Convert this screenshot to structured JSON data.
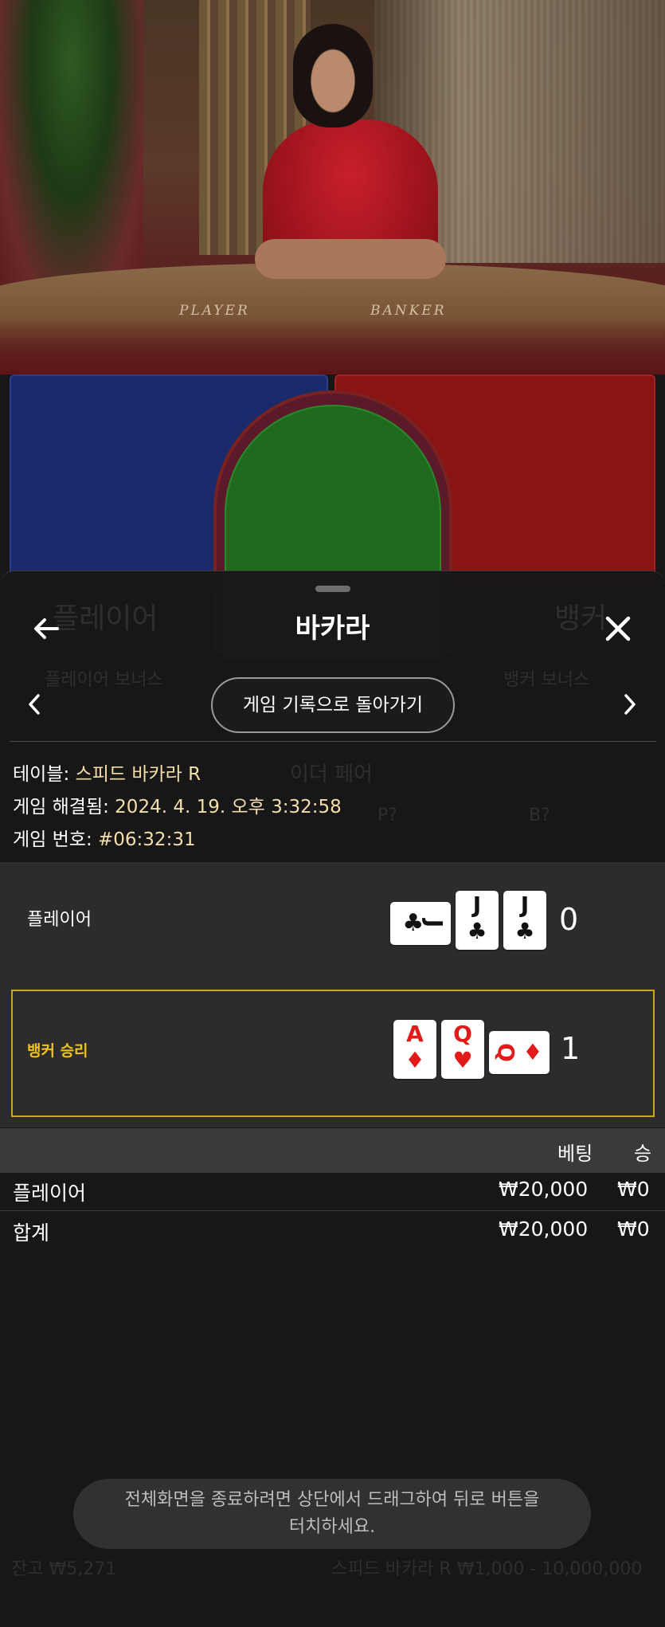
{
  "video": {
    "table_label_player": "PLAYER",
    "table_label_banker": "BANKER"
  },
  "sheet": {
    "title": "바카라",
    "back_icon": "arrow-left-icon",
    "close_icon": "close-icon",
    "history_button": "게임 기록으로 돌아가기",
    "prev_icon": "chevron-left-icon",
    "next_icon": "chevron-right-icon"
  },
  "background_ghost": {
    "player": "플레이어",
    "banker": "뱅커",
    "player_bonus": "플레이어 보너스",
    "banker_bonus": "뱅커 보너스",
    "either_pair": "이더 페어",
    "player_pair_hint": "P?",
    "banker_pair_hint": "B?",
    "balance_ghost": "잔고 ₩5,271",
    "table_limits_ghost": "스피드 바카라 R  ₩1,000 - 10,000,000"
  },
  "game_info": {
    "table_label": "테이블: ",
    "table_value": "스피드 바카라 R",
    "resolved_label": "게임 해결됨: ",
    "resolved_value": "2024. 4. 19. 오후 3:32:58",
    "number_label": "게임 번호: ",
    "number_value": "#06:32:31"
  },
  "results": {
    "player": {
      "label": "플레이어",
      "score": "0",
      "cards": [
        {
          "rank": "J",
          "suit": "♣",
          "color": "black",
          "orientation": "sideways"
        },
        {
          "rank": "J",
          "suit": "♣",
          "color": "black",
          "orientation": "upright"
        },
        {
          "rank": "J",
          "suit": "♣",
          "color": "black",
          "orientation": "upright"
        }
      ]
    },
    "banker": {
      "label": "뱅커 승리",
      "score": "1",
      "cards": [
        {
          "rank": "A",
          "suit": "♦",
          "color": "red",
          "orientation": "upright"
        },
        {
          "rank": "Q",
          "suit": "♥",
          "color": "red",
          "orientation": "upright"
        },
        {
          "rank": "Q",
          "suit": "♦",
          "color": "red",
          "orientation": "sideways"
        }
      ]
    }
  },
  "bets_table": {
    "col_bet": "베팅",
    "col_win": "승",
    "rows": [
      {
        "label": "플레이어",
        "bet": "₩20,000",
        "win": "₩0"
      }
    ],
    "total": {
      "label": "합계",
      "bet": "₩20,000",
      "win": "₩0"
    }
  },
  "toast": {
    "line1": "전체화면을 종료하려면 상단에서 드래그하여 뒤로 버튼을",
    "line2": "터치하세요."
  },
  "colors": {
    "accent_gold": "#f2c21a",
    "banker_red": "#8a1414",
    "player_blue": "#1a2a6a",
    "tie_green": "#1f6a1f"
  }
}
